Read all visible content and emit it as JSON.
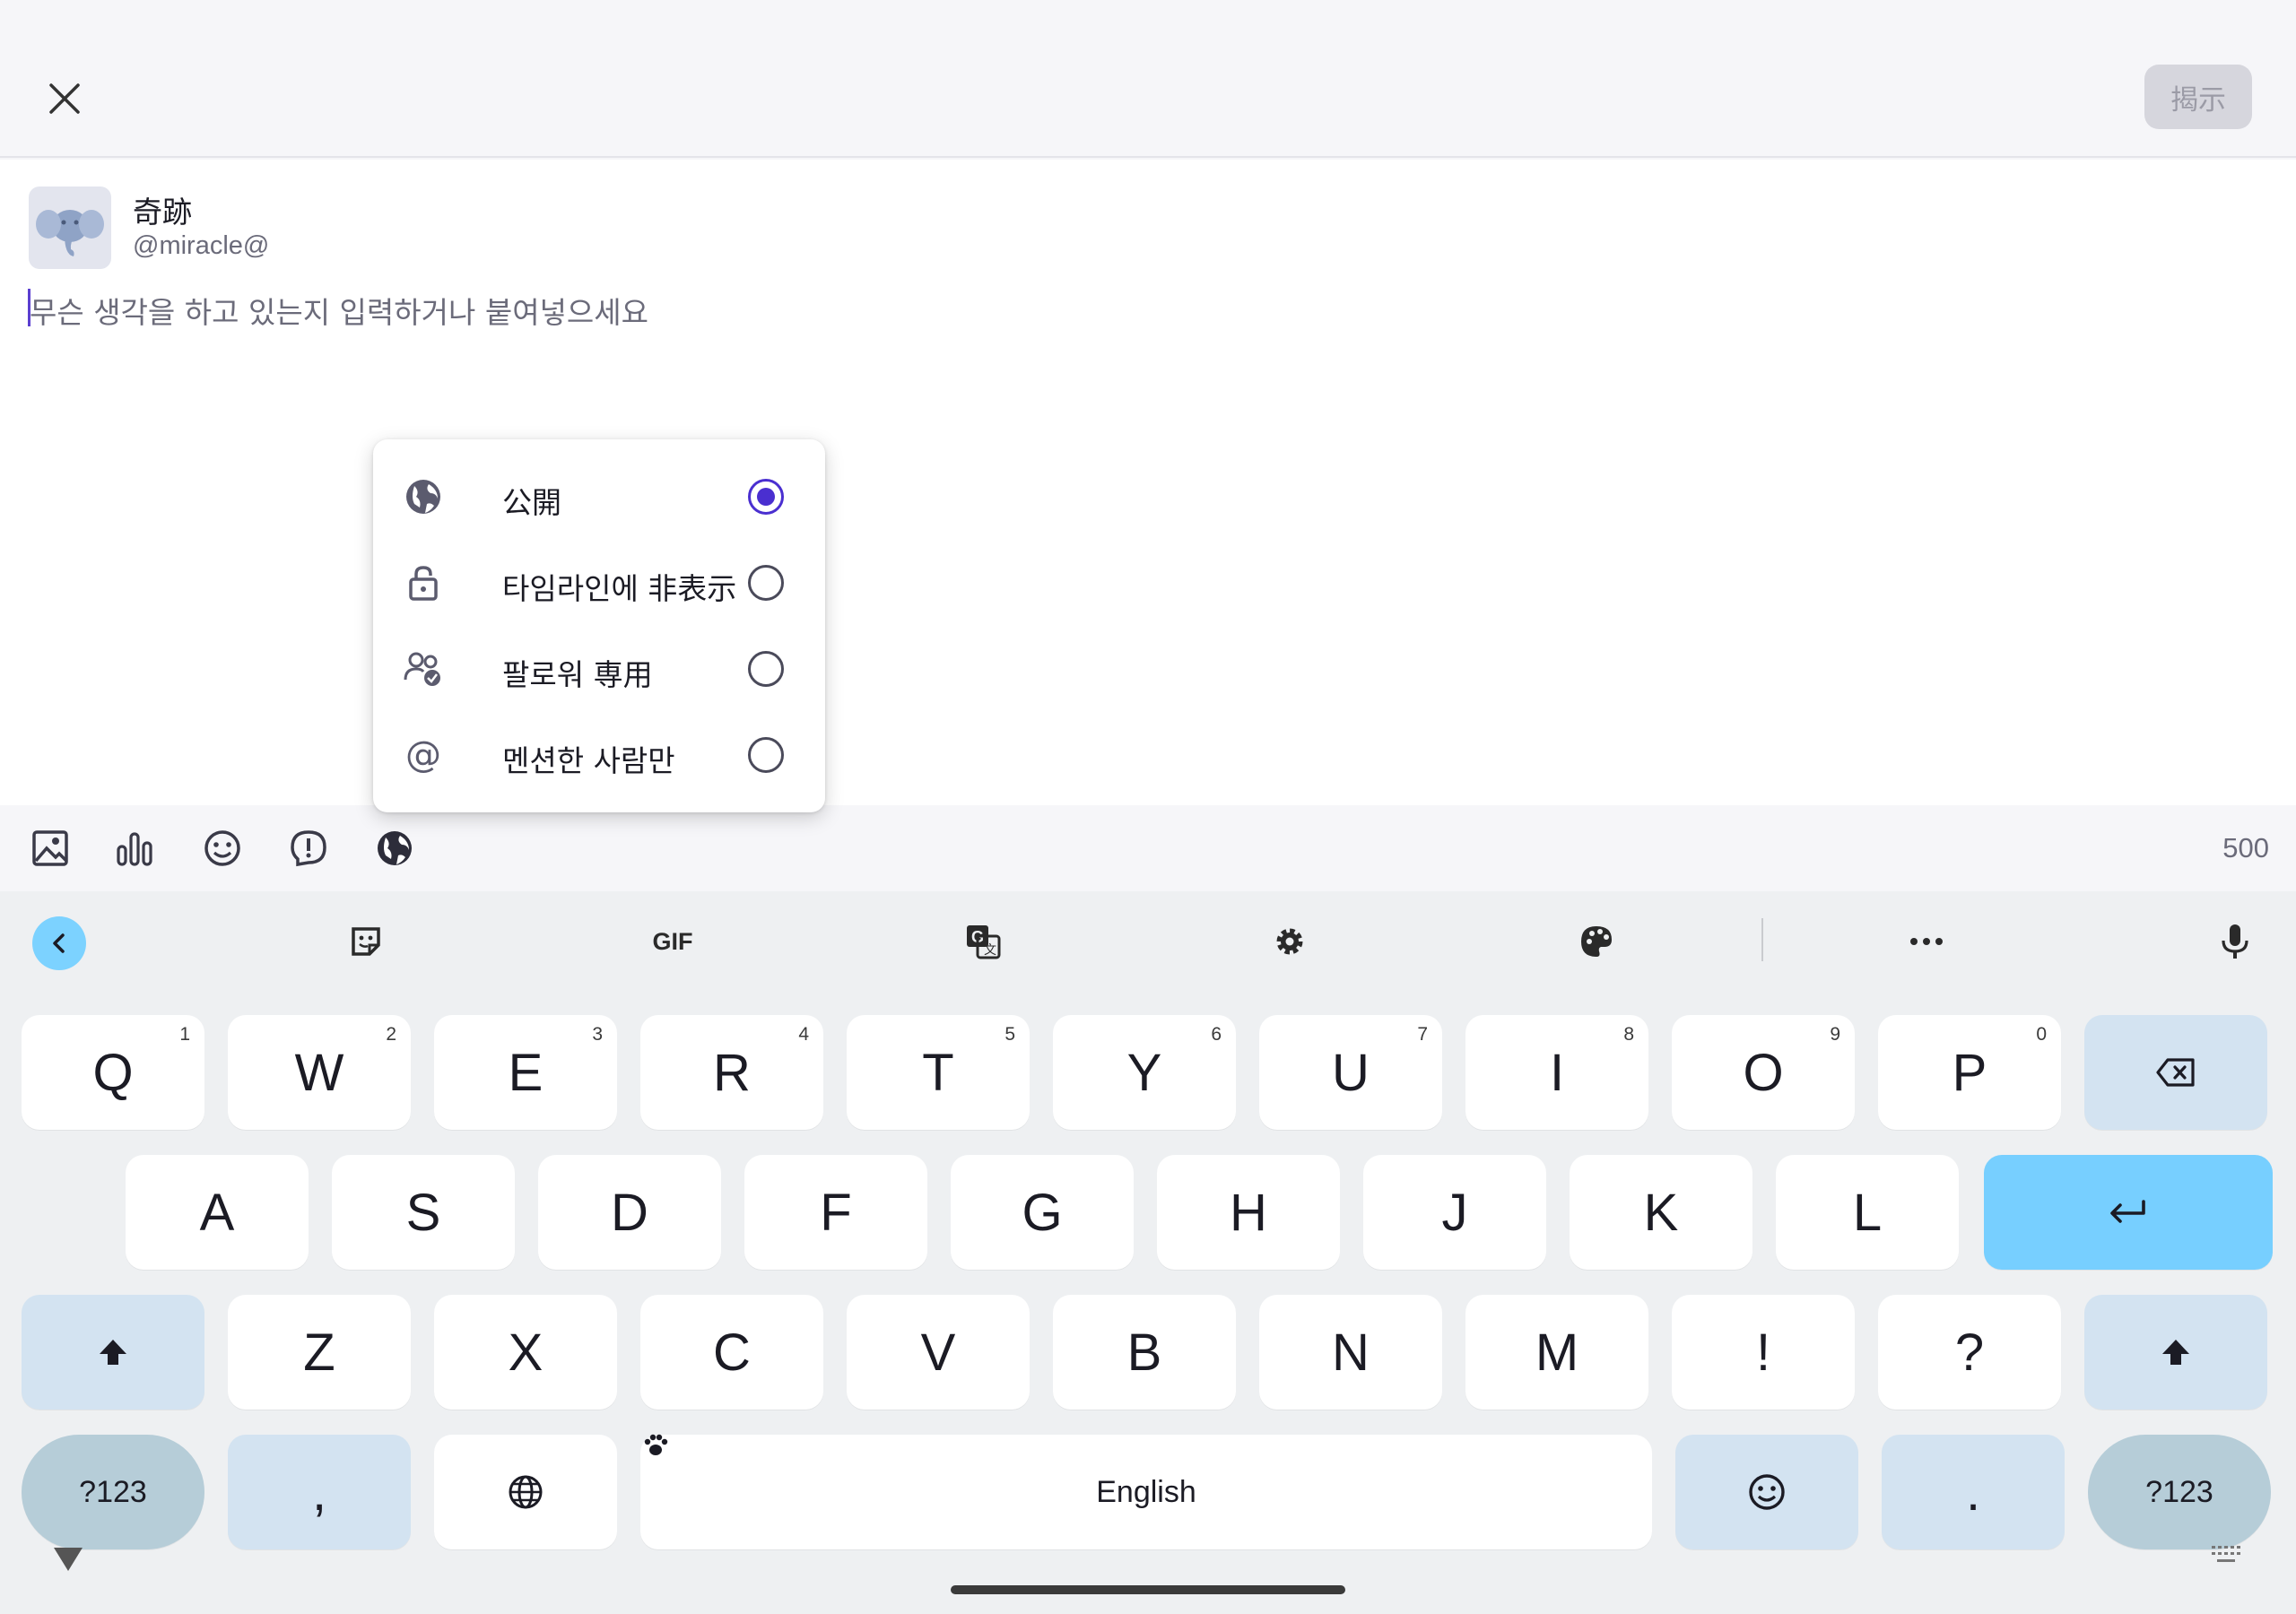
{
  "status_bar": {
    "icons": [
      "wifi-icon",
      "cell-signal-icon",
      "battery-icon"
    ]
  },
  "app_bar": {
    "close_icon": "close-icon",
    "post_label": "揭示"
  },
  "account": {
    "display_name": "奇跡",
    "username": "@miracle@",
    "avatar_icon": "elephant-avatar-icon"
  },
  "compose": {
    "placeholder": "무슨 생각을 하고 있는지 입력하거나 붙여넣으세요"
  },
  "visibility_menu": {
    "items": [
      {
        "label": "公開",
        "icon": "globe-icon",
        "selected": true
      },
      {
        "label": "타임라인에 非表示",
        "icon": "unlock-icon",
        "selected": false
      },
      {
        "label": "팔로워 専用",
        "icon": "followers-icon",
        "selected": false
      },
      {
        "label": "멘션한 사람만",
        "icon": "at-icon",
        "selected": false
      }
    ]
  },
  "toolbar": {
    "icons": [
      "image-icon",
      "poll-icon",
      "emoji-icon",
      "content-warning-icon",
      "visibility-globe-icon"
    ],
    "char_count": "500"
  },
  "keyboard": {
    "toolbar": {
      "icons": [
        "back-icon",
        "sticker-icon",
        "gif-icon",
        "translate-icon",
        "settings-icon",
        "palette-icon",
        "more-icon",
        "mic-icon"
      ],
      "gif_label": "GIF"
    },
    "row1": [
      {
        "key": "Q",
        "hint": "1"
      },
      {
        "key": "W",
        "hint": "2"
      },
      {
        "key": "E",
        "hint": "3"
      },
      {
        "key": "R",
        "hint": "4"
      },
      {
        "key": "T",
        "hint": "5"
      },
      {
        "key": "Y",
        "hint": "6"
      },
      {
        "key": "U",
        "hint": "7"
      },
      {
        "key": "I",
        "hint": "8"
      },
      {
        "key": "O",
        "hint": "9"
      },
      {
        "key": "P",
        "hint": "0"
      }
    ],
    "row2": [
      "A",
      "S",
      "D",
      "F",
      "G",
      "H",
      "J",
      "K",
      "L"
    ],
    "row3": [
      "Z",
      "X",
      "C",
      "V",
      "B",
      "N",
      "M",
      "!",
      "?"
    ],
    "symbols_label": "?123",
    "comma_label": ",",
    "space_label": "English",
    "period_label": ".",
    "colors": {
      "enter": "#77cfff",
      "special": "#d3e3f1",
      "accent": "#4a2fd0"
    }
  }
}
